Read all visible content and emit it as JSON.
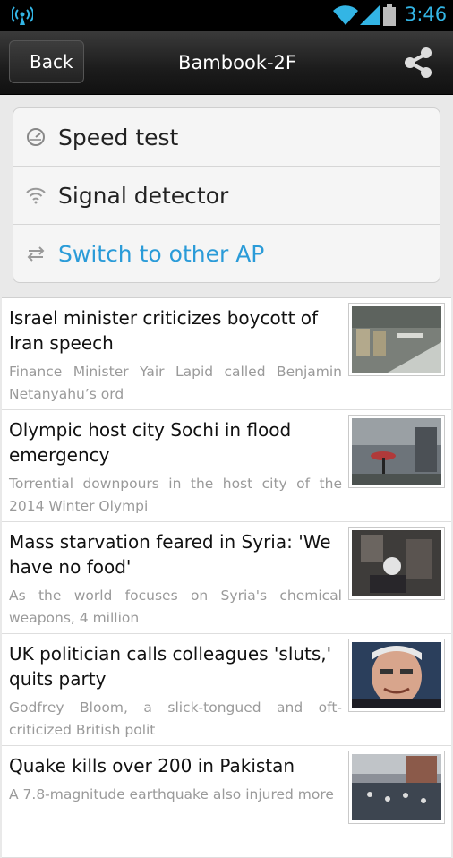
{
  "status_bar": {
    "time": "3:46",
    "icons": [
      "radio-icon",
      "wifi-icon",
      "signal-icon",
      "battery-icon"
    ],
    "accent_color": "#33b5e5"
  },
  "action_bar": {
    "back_label": "Back",
    "title": "Bambook-2F",
    "share_icon": "share-icon"
  },
  "menu": {
    "items": [
      {
        "label": "Speed test",
        "icon": "speedometer-icon"
      },
      {
        "label": "Signal detector",
        "icon": "wifi-icon"
      },
      {
        "label": "Switch to other AP",
        "icon": "swap-arrows-icon",
        "color": "#2a9bd8"
      }
    ]
  },
  "news": {
    "items": [
      {
        "headline": "Israel minister criticizes boycott of Iran speech",
        "summary": "Finance Minister Yair Lapid called Benjamin Netanyahu’s ord"
      },
      {
        "headline": "Olympic host city Sochi in flood emergency",
        "summary": "Torrential downpours in the host city of the 2014 Winter Olympi"
      },
      {
        "headline": "Mass starvation feared in Syria: 'We have no food'",
        "summary": "As the world focuses on Syria's chemical weapons, 4 million"
      },
      {
        "headline": "UK politician calls colleagues 'sluts,' quits party",
        "summary": "Godfrey Bloom, a slick-tongued and oft-criticized British polit"
      },
      {
        "headline": "Quake kills over 200 in Pakistan",
        "summary": "A 7.8-magnitude earthquake also injured more"
      }
    ]
  }
}
